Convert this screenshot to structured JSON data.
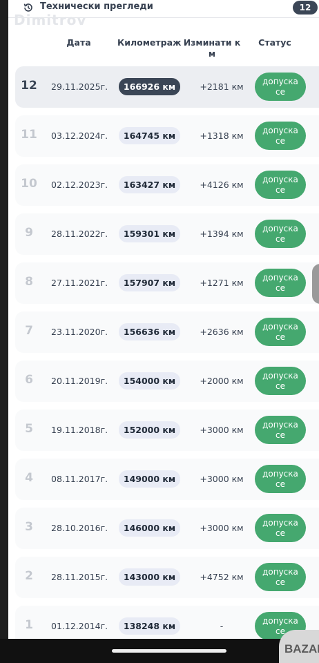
{
  "header": {
    "title": "Технически прегледи",
    "count": "12",
    "watermark": "Dimitrov"
  },
  "columns": {
    "date": "Дата",
    "mileage": "Километраж",
    "change": "Изминати к\nм",
    "status": "Статус"
  },
  "rows": [
    {
      "num": "12",
      "date": "29.11.2025г.",
      "km": "166926 км",
      "diff": "+2181 км",
      "status": "допуска\nсе"
    },
    {
      "num": "11",
      "date": "03.12.2024г.",
      "km": "164745 км",
      "diff": "+1318 км",
      "status": "допуска\nсе"
    },
    {
      "num": "10",
      "date": "02.12.2023г.",
      "km": "163427 км",
      "diff": "+4126 км",
      "status": "допуска\nсе"
    },
    {
      "num": "9",
      "date": "28.11.2022г.",
      "km": "159301 км",
      "diff": "+1394 км",
      "status": "допуска\nсе"
    },
    {
      "num": "8",
      "date": "27.11.2021г.",
      "km": "157907 км",
      "diff": "+1271 км",
      "status": "допуска\nсе"
    },
    {
      "num": "7",
      "date": "23.11.2020г.",
      "km": "156636 км",
      "diff": "+2636 км",
      "status": "допуска\nсе"
    },
    {
      "num": "6",
      "date": "20.11.2019г.",
      "km": "154000 км",
      "diff": "+2000 км",
      "status": "допуска\nсе"
    },
    {
      "num": "5",
      "date": "19.11.2018г.",
      "km": "152000 км",
      "diff": "+3000 км",
      "status": "допуска\nсе"
    },
    {
      "num": "4",
      "date": "08.11.2017г.",
      "km": "149000 км",
      "diff": "+3000 км",
      "status": "допуска\nсе"
    },
    {
      "num": "3",
      "date": "28.10.2016г.",
      "km": "146000 км",
      "diff": "+3000 км",
      "status": "допуска\nсе"
    },
    {
      "num": "2",
      "date": "28.11.2015г.",
      "km": "143000 км",
      "diff": "+4752 км",
      "status": "допуска\nсе"
    },
    {
      "num": "1",
      "date": "01.12.2014г.",
      "km": "138248 км",
      "diff": "-",
      "status": "допуска\nсе"
    }
  ],
  "logo": "BAZAR",
  "colors": {
    "accent_dark": "#3b4656",
    "status_green": "#45a86f",
    "km_pill": "#e8ebf5"
  }
}
